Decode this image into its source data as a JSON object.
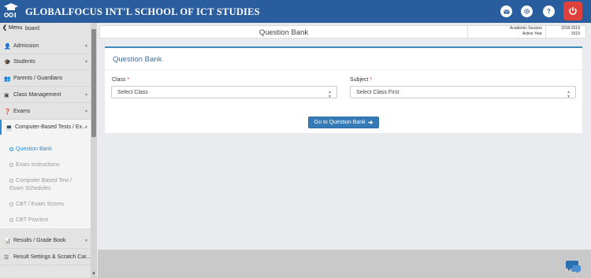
{
  "header": {
    "school_name": "GLOBALFOCUS INT'L SCHOOL OF ICT STUDIES",
    "icons": [
      "mail-icon",
      "settings-icon",
      "help-icon",
      "power-icon"
    ],
    "help_glyph": "?",
    "brand_color": "#2a5d9d",
    "logout_color": "#e0403a"
  },
  "sidebar": {
    "menu_label": "Menu",
    "menu_sub": "board",
    "items": [
      {
        "label": "Admission",
        "icon": "user-plus-icon"
      },
      {
        "label": "Students",
        "icon": "graduation-cap-icon"
      },
      {
        "label": "Parents / Guardians",
        "icon": "users-icon"
      },
      {
        "label": "Class Management",
        "icon": "chalkboard-icon"
      },
      {
        "label": "Exams",
        "icon": "question-circle-icon"
      },
      {
        "label": "Computer-Based Tests / Ex...",
        "icon": "laptop-icon"
      },
      {
        "label": "Results / Grade Book",
        "icon": "bar-chart-icon"
      },
      {
        "label": "Result Settings & Scratch Car...",
        "icon": "sliders-icon"
      }
    ],
    "sub_items": [
      {
        "label": "Question Bank"
      },
      {
        "label": "Exam Instructions"
      },
      {
        "label": "Computer Based Test /",
        "label2": "Exam Schedules"
      },
      {
        "label": "CBT / Exam Scores"
      },
      {
        "label": "CBT Practice"
      }
    ],
    "active_color": "#2a8bd8"
  },
  "titlebar": {
    "title": "Question Bank",
    "session_label": "Academic Session",
    "session_value": "2018-2019",
    "year_label": "Active Year",
    "year_value": "2019"
  },
  "panel": {
    "title": "Question Bank",
    "class_label": "Class",
    "class_value": "Select Class",
    "subject_label": "Subject",
    "subject_value": "Select Class First",
    "required_mark": "*",
    "go_label": "Go to Question Bank"
  }
}
